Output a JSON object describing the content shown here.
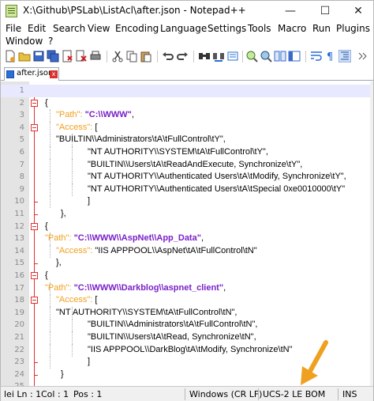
{
  "window": {
    "title": "X:\\Github\\PSLab\\ListAcl\\after.json - Notepad++",
    "minimize": "—",
    "maximize": "☐",
    "close": "✕"
  },
  "menu": {
    "items": [
      "File",
      "Edit",
      "Search",
      "View",
      "Encoding",
      "Language",
      "Settings",
      "Tools",
      "Macro",
      "Run",
      "Plugins"
    ],
    "row2": [
      "Window",
      "?"
    ]
  },
  "tab": {
    "label": "after.json",
    "close": "x"
  },
  "editor": {
    "lines": [
      {
        "n": "1",
        "text": ""
      },
      {
        "n": "2",
        "text": "{"
      },
      {
        "n": "3",
        "key": "\"Path\":",
        "val": "\"C:\\\\WWW\"",
        "tail": ","
      },
      {
        "n": "4",
        "key": "\"Access\":",
        "tail": " ["
      },
      {
        "n": "5",
        "text": "\"BUILTIN\\\\Administrators\\tA\\tFullControl\\tY\","
      },
      {
        "n": "6",
        "text": "\"NT AUTHORITY\\\\SYSTEM\\tA\\tFullControl\\tY\","
      },
      {
        "n": "7",
        "text": "\"BUILTIN\\\\Users\\tA\\tReadAndExecute, Synchronize\\tY\","
      },
      {
        "n": "8",
        "text": "\"NT AUTHORITY\\\\Authenticated Users\\tA\\tModify, Synchronize\\tY\","
      },
      {
        "n": "9",
        "text": "\"NT AUTHORITY\\\\Authenticated Users\\tA\\tSpecial 0xe0010000\\tY\""
      },
      {
        "n": "10",
        "text": "]"
      },
      {
        "n": "11",
        "text": "},"
      },
      {
        "n": "12",
        "text": "{"
      },
      {
        "n": "13",
        "key": "\"Path\":",
        "val": "\"C:\\\\WWW\\\\AspNet\\\\App_Data\"",
        "tail": ","
      },
      {
        "n": "14",
        "key": "\"Access\":",
        "tail": " \"IIS APPPOOL\\\\AspNet\\tA\\tFullControl\\tN\""
      },
      {
        "n": "15",
        "text": "},"
      },
      {
        "n": "16",
        "text": "{"
      },
      {
        "n": "17",
        "key": "\"Path\":",
        "val": "\"C:\\\\WWW\\\\Darkblog\\\\aspnet_client\"",
        "tail": ","
      },
      {
        "n": "18",
        "key": "\"Access\":",
        "tail": " ["
      },
      {
        "n": "19",
        "text": "\"NT AUTHORITY\\\\SYSTEM\\tA\\tFullControl\\tN\","
      },
      {
        "n": "20",
        "text": "\"BUILTIN\\\\Administrators\\tA\\tFullControl\\tN\","
      },
      {
        "n": "21",
        "text": "\"BUILTIN\\\\Users\\tA\\tRead, Synchronize\\tN\","
      },
      {
        "n": "22",
        "text": "\"IIS APPPOOL\\\\DarkBlog\\tA\\tModify, Synchronize\\tN\""
      },
      {
        "n": "23",
        "text": "]"
      },
      {
        "n": "24",
        "text": "}"
      },
      {
        "n": "25",
        "text": ""
      }
    ]
  },
  "status": {
    "ln": "lei Ln : 1",
    "col": "Col : 1",
    "pos": "Pos : 1",
    "eol": "Windows (CR LF)",
    "encoding": "UCS-2 LE BOM",
    "mode": "INS"
  },
  "colors": {
    "fold_marker": "#e03030",
    "key": "#f0a020",
    "string_value": "#7a20c8",
    "arrow": "#f0a020"
  }
}
